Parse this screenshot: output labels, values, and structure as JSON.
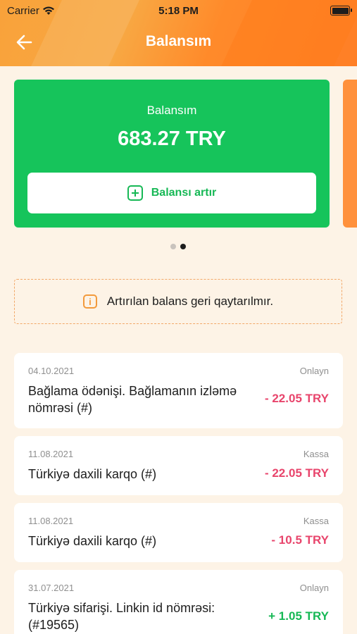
{
  "status_bar": {
    "carrier": "Carrier",
    "time": "5:18 PM"
  },
  "header": {
    "title": "Balansım"
  },
  "balance_card": {
    "label": "Balansım",
    "amount": "683.27 TRY",
    "add_button_label": "Balansı artır"
  },
  "pager": {
    "total": 2,
    "active": 2
  },
  "notice": {
    "text": "Artırılan balans geri qaytarılmır."
  },
  "transactions": [
    {
      "date": "04.10.2021",
      "method": "Onlayn",
      "description": "Bağlama ödənişi. Bağlamanın izləmə nömrəsi (#)",
      "amount": "- 22.05 TRY",
      "sign": "negative"
    },
    {
      "date": "11.08.2021",
      "method": "Kassa",
      "description": "Türkiyə daxili karqo (#)",
      "amount": "- 22.05 TRY",
      "sign": "negative"
    },
    {
      "date": "11.08.2021",
      "method": "Kassa",
      "description": "Türkiyə daxili karqo (#)",
      "amount": "- 10.5 TRY",
      "sign": "negative"
    },
    {
      "date": "31.07.2021",
      "method": "Onlayn",
      "description": "Türkiyə sifarişi. Linkin id nömrəsi: (#19565)",
      "amount": "+ 1.05 TRY",
      "sign": "positive"
    }
  ],
  "colors": {
    "header_orange": "#f9a23a",
    "card_green": "#16c45b",
    "negative": "#e8456c",
    "positive": "#16b855",
    "background": "#fdf3e6"
  },
  "icons": [
    "wifi-icon",
    "battery-icon",
    "back-arrow-icon",
    "plus-icon",
    "info-icon"
  ]
}
